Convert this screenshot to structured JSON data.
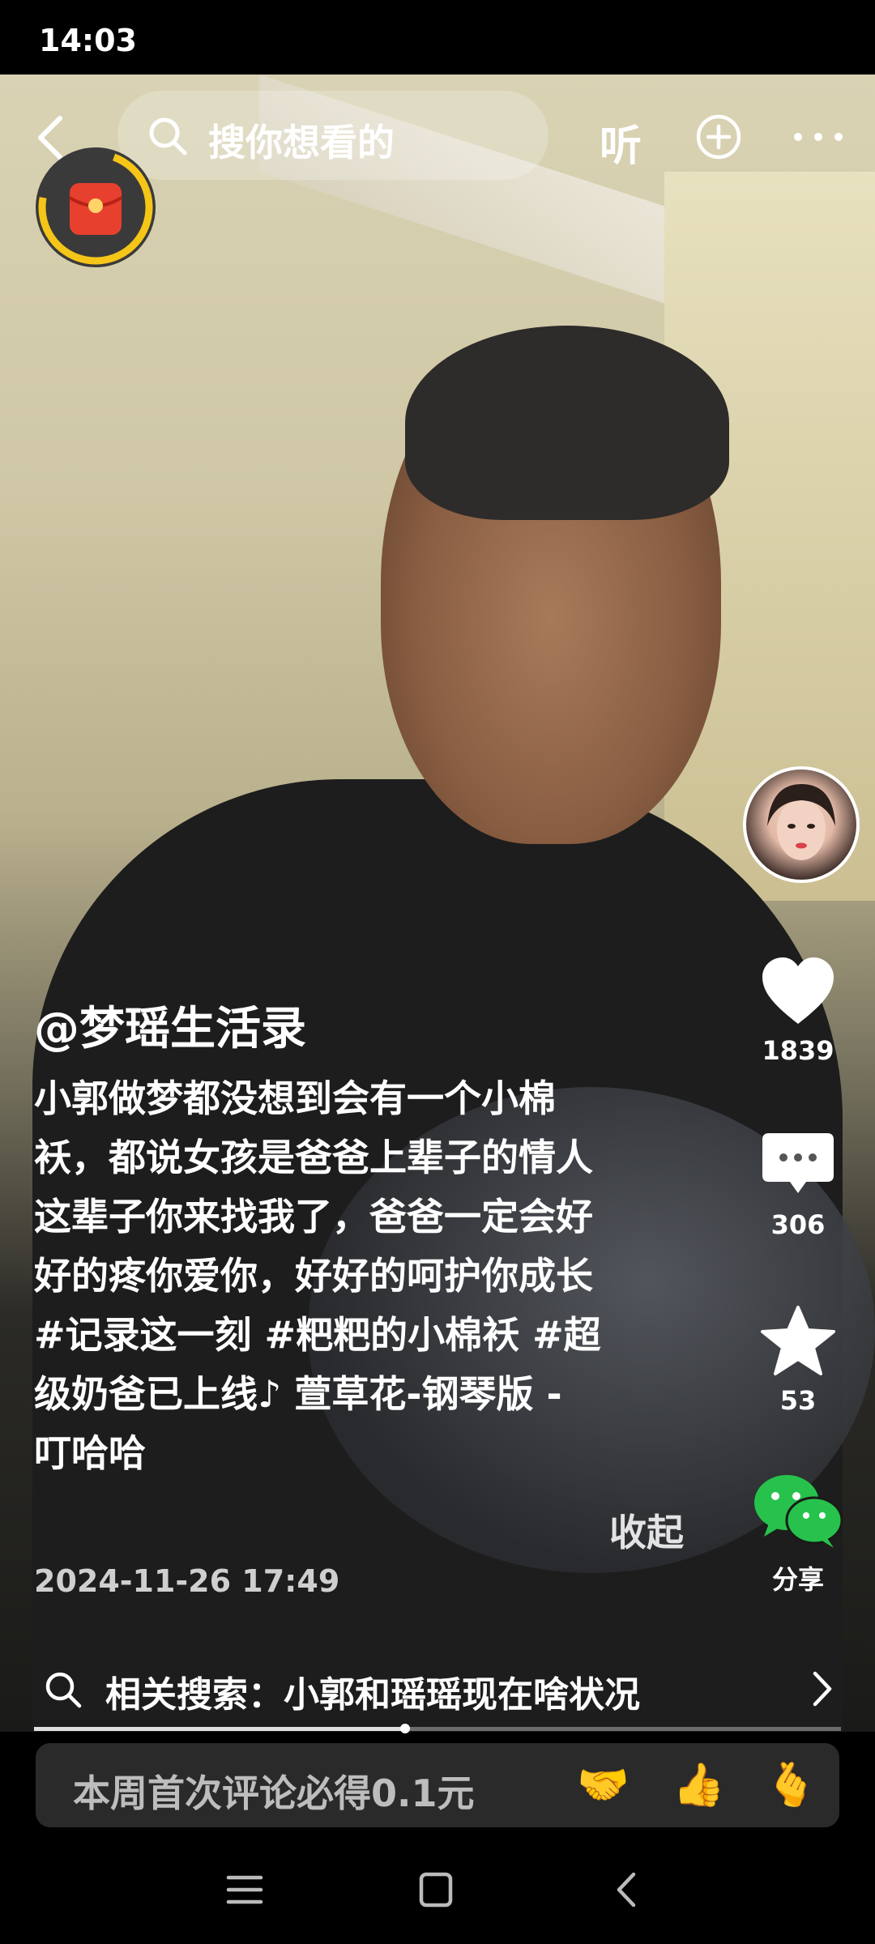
{
  "status_bar": {
    "time": "14:03"
  },
  "top_bar": {
    "search_placeholder": "搜你想看的",
    "listen_label": "听"
  },
  "icons": {
    "back": "back-arrow-icon",
    "search": "search-icon",
    "plus": "plus-circle-icon",
    "more": "more-dots-icon",
    "red_packet": "red-packet-icon",
    "like": "heart-icon",
    "comment": "comment-bubble-icon",
    "favorite": "star-icon",
    "share": "wechat-icon"
  },
  "colors": {
    "accent_ring": "#f5c518",
    "wechat_green": "#27c24c",
    "red_packet": "#e8402f"
  },
  "right_rail": {
    "likes": "1839",
    "comments": "306",
    "favorites": "53",
    "share_label": "分享"
  },
  "post": {
    "author": "@梦瑶生活录",
    "caption_line1": "小郭做梦都没想到会有一个小棉",
    "caption_line2": "袄，都说女孩是爸爸上辈子的情人",
    "caption_line3": "这辈子你来找我了，爸爸一定会好",
    "caption_line4": "好的疼你爱你，好好的呵护你成长",
    "tags_line1": "#记录这一刻 #粑粑的小棉袄 #超",
    "tags_line2": "级奶爸已上线♪ 萱草花-钢琴版 -",
    "tags_line3": "叮哈哈",
    "collapse_label": "收起",
    "date": "2024-11-26 17:49"
  },
  "related_search": {
    "text": "相关搜索：小郭和瑶瑶现在啥状况"
  },
  "progress": {
    "played_fraction": 0.46
  },
  "comment_bar": {
    "placeholder": "本周首次评论必得0.1元",
    "emojis": [
      "🤝",
      "👍",
      "🫰"
    ]
  },
  "nav_bar": {
    "menu": "menu-icon",
    "home": "square-home-icon",
    "back": "back-triangle-icon"
  }
}
